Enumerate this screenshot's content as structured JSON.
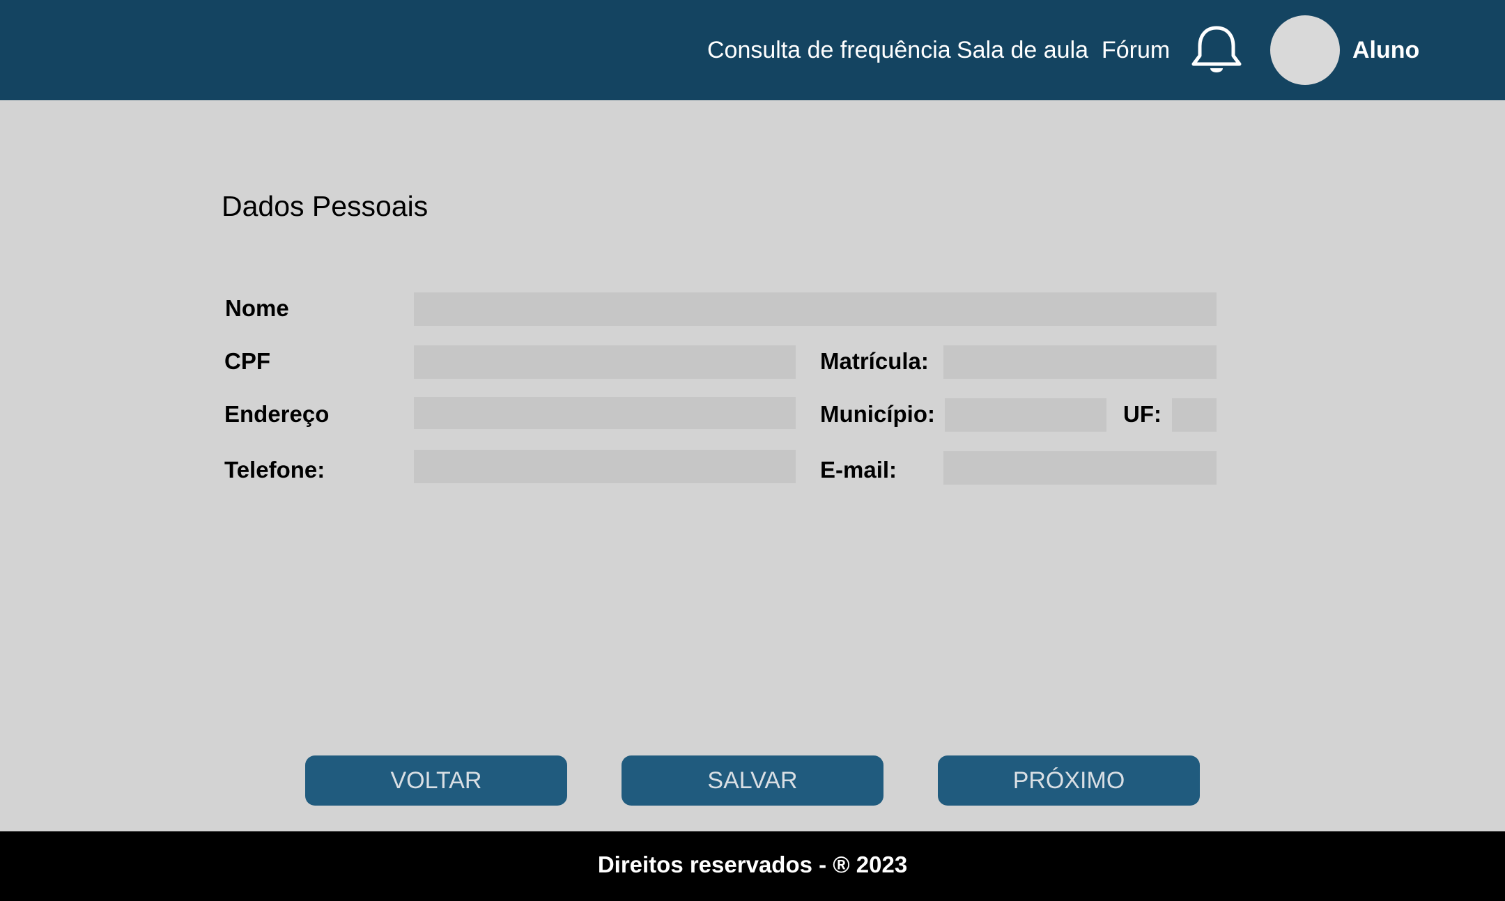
{
  "header": {
    "nav": [
      {
        "label": "Consulta de frequência"
      },
      {
        "label": "Sala de aula"
      },
      {
        "label": "Fórum"
      }
    ],
    "notification_icon": "bell-icon",
    "user": {
      "name": "Aluno"
    }
  },
  "form": {
    "title": "Dados Pessoais",
    "labels": {
      "nome": "Nome",
      "cpf": "CPF",
      "matricula": "Matrícula:",
      "endereco": "Endereço",
      "municipio": "Município:",
      "uf": "UF:",
      "telefone": "Telefone:",
      "email": "E-mail:"
    },
    "values": {
      "nome": "",
      "cpf": "",
      "matricula": "",
      "endereco": "",
      "municipio": "",
      "uf": "",
      "telefone": "",
      "email": ""
    }
  },
  "buttons": {
    "voltar": "VOLTAR",
    "salvar": "SALVAR",
    "proximo": "PRÓXIMO"
  },
  "footer": {
    "text": "Direitos reservados - ® 2023"
  },
  "colors": {
    "header_bg": "#144461",
    "page_bg": "#d3d3d3",
    "field_bg": "#c6c6c6",
    "button_bg": "#205b7e",
    "button_text": "#d9dfe4",
    "footer_bg": "#000000"
  }
}
